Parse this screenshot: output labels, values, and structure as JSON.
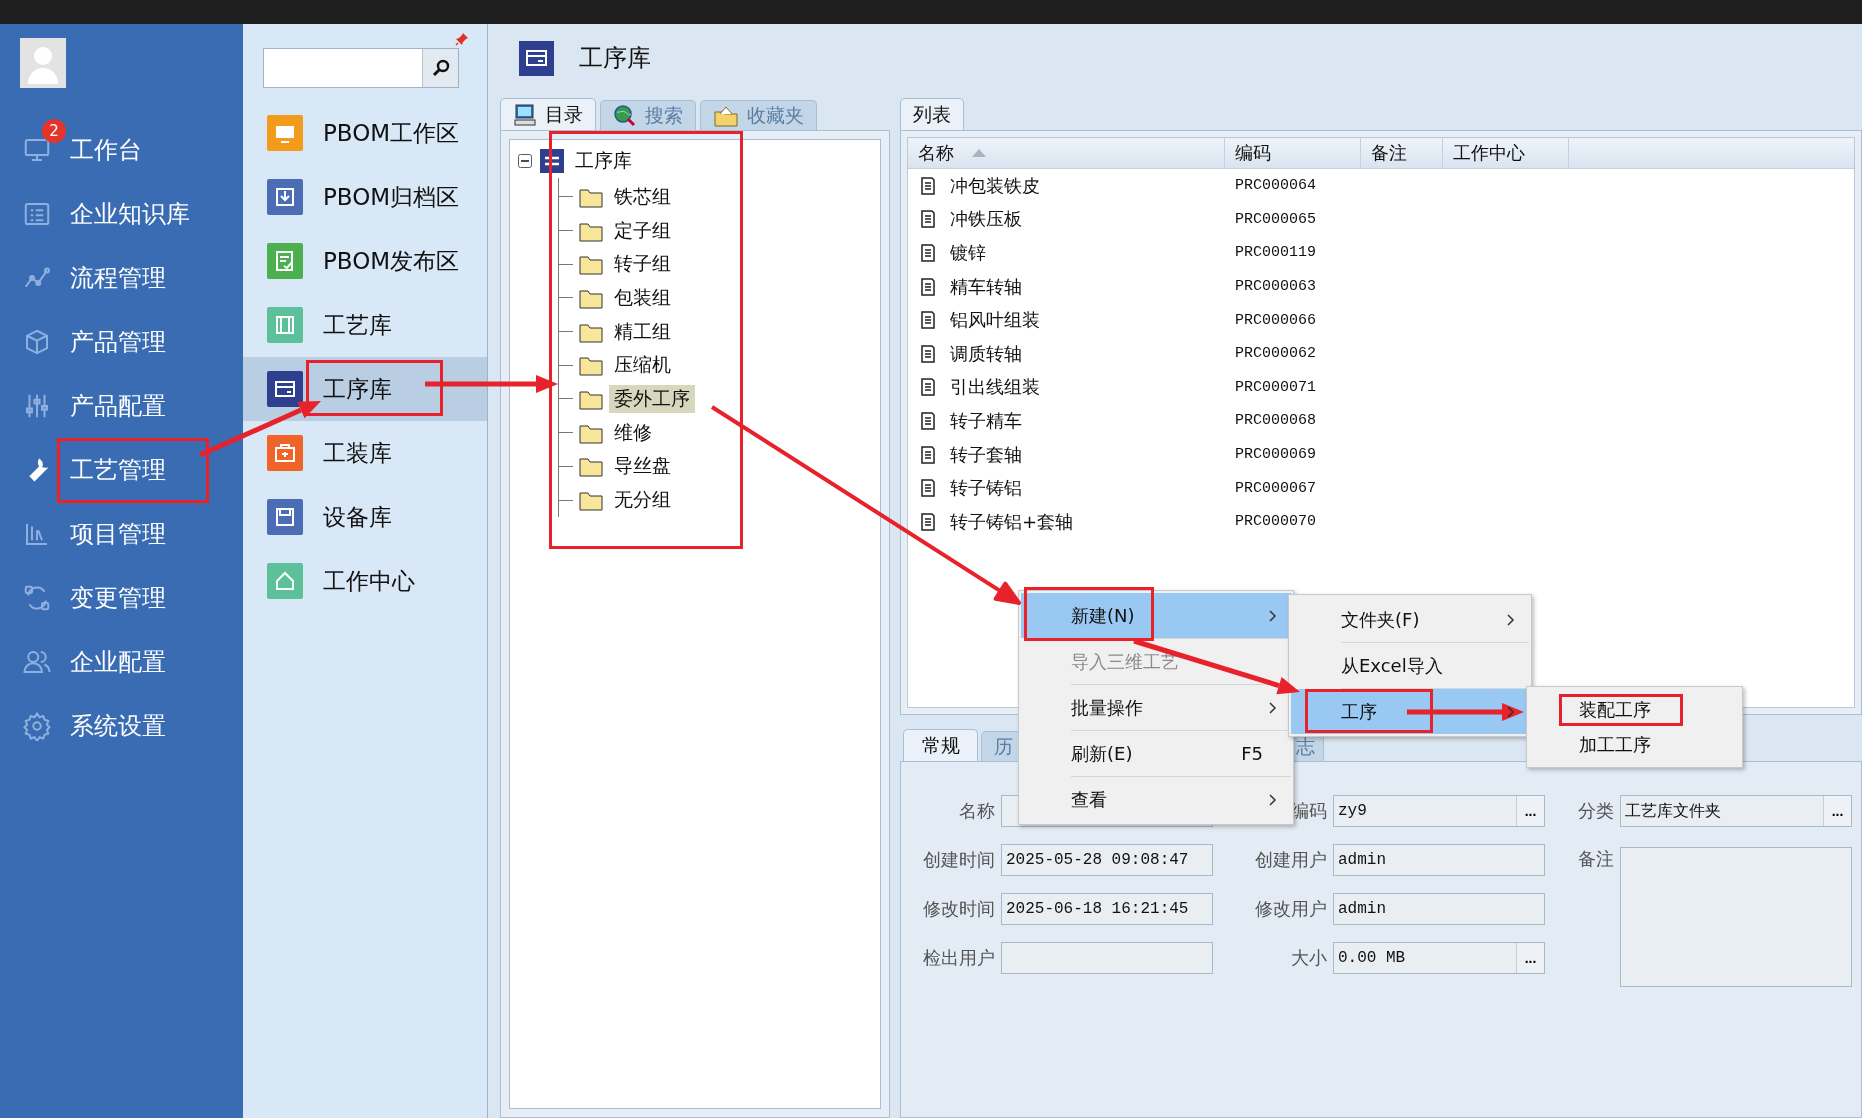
{
  "nav": {
    "items": [
      {
        "label": "工作台",
        "badge": "2",
        "selected": false
      },
      {
        "label": "企业知识库",
        "selected": false
      },
      {
        "label": "流程管理",
        "selected": false
      },
      {
        "label": "产品管理",
        "selected": false
      },
      {
        "label": "产品配置",
        "selected": false
      },
      {
        "label": "工艺管理",
        "selected": true
      },
      {
        "label": "项目管理",
        "selected": false
      },
      {
        "label": "变更管理",
        "selected": false
      },
      {
        "label": "企业配置",
        "selected": false
      },
      {
        "label": "系统设置",
        "selected": false
      }
    ]
  },
  "subnav": {
    "items": [
      {
        "label": "PBOM工作区",
        "color": "#f39c1b",
        "selected": false
      },
      {
        "label": "PBOM归档区",
        "color": "#4a6db5",
        "selected": false
      },
      {
        "label": "PBOM发布区",
        "color": "#4caf50",
        "selected": false
      },
      {
        "label": "工艺库",
        "color": "#5cc19b",
        "selected": false
      },
      {
        "label": "工序库",
        "color": "#2e3f8f",
        "selected": true
      },
      {
        "label": "工装库",
        "color": "#f0642a",
        "selected": false
      },
      {
        "label": "设备库",
        "color": "#4a6db5",
        "selected": false
      },
      {
        "label": "工作中心",
        "color": "#5cc19b",
        "selected": false
      }
    ]
  },
  "page": {
    "title": "工序库"
  },
  "left_tabs": [
    {
      "label": "目录",
      "selected": true
    },
    {
      "label": "搜索",
      "selected": false
    },
    {
      "label": "收藏夹",
      "selected": false
    }
  ],
  "tree": {
    "label": "工序库",
    "expanded": true,
    "children": [
      {
        "label": "铁芯组",
        "selected": false
      },
      {
        "label": "定子组",
        "selected": false
      },
      {
        "label": "转子组",
        "selected": false
      },
      {
        "label": "包装组",
        "selected": false
      },
      {
        "label": "精工组",
        "selected": false
      },
      {
        "label": "压缩机",
        "selected": false
      },
      {
        "label": "委外工序",
        "selected": true
      },
      {
        "label": "维修",
        "selected": false
      },
      {
        "label": "导丝盘",
        "selected": false
      },
      {
        "label": "无分组",
        "selected": false
      }
    ]
  },
  "list_tabs": [
    {
      "label": "列表",
      "selected": true
    }
  ],
  "table": {
    "columns": [
      {
        "label": "名称",
        "sorted": true
      },
      {
        "label": "编码",
        "sorted": false
      },
      {
        "label": "备注",
        "sorted": false
      },
      {
        "label": "工作中心",
        "sorted": false
      }
    ],
    "rows": [
      {
        "name": "冲包装铁皮",
        "code": "PRC000064"
      },
      {
        "name": "冲铁压板",
        "code": "PRC000065"
      },
      {
        "name": "镀锌",
        "code": "PRC000119"
      },
      {
        "name": "精车转轴",
        "code": "PRC000063"
      },
      {
        "name": "铝风叶组装",
        "code": "PRC000066"
      },
      {
        "name": "调质转轴",
        "code": "PRC000062"
      },
      {
        "name": "引出线组装",
        "code": "PRC000071"
      },
      {
        "name": "转子精车",
        "code": "PRC000068"
      },
      {
        "name": "转子套轴",
        "code": "PRC000069"
      },
      {
        "name": "转子铸铝",
        "code": "PRC000067"
      },
      {
        "name": "转子铸铝+套轴",
        "code": "PRC000070"
      }
    ]
  },
  "detail_tabs": [
    {
      "label": "常规",
      "selected": true
    },
    {
      "label": "历",
      "selected": false
    },
    {
      "label": "志",
      "selected": false
    }
  ],
  "form": {
    "rows": [
      [
        {
          "label": "名称",
          "kind": "text"
        },
        {
          "label": "编码",
          "kind": "picker",
          "value": "zy9",
          "button": "..."
        },
        {
          "label": "分类",
          "kind": "picker",
          "value": "工艺库文件夹",
          "button": "..."
        }
      ],
      [
        {
          "label": "创建时间",
          "kind": "text",
          "value": "2025-05-28 09:08:47"
        },
        {
          "label": "创建用户",
          "kind": "text",
          "value": "admin"
        },
        {
          "label": "备注",
          "kind": "textarea"
        }
      ],
      [
        {
          "label": "修改时间",
          "kind": "text",
          "value": "2025-06-18 16:21:45"
        },
        {
          "label": "修改用户",
          "kind": "text",
          "value": "admin"
        }
      ],
      [
        {
          "label": "检出用户",
          "kind": "text"
        },
        {
          "label": "大小",
          "kind": "picker",
          "value": "0.00 MB",
          "button": "..."
        }
      ]
    ]
  },
  "context_menu": {
    "items": [
      {
        "label": "新建(N)",
        "highlighted": true,
        "disabled": false,
        "submenu": true
      },
      {
        "label": "导入三维工艺",
        "highlighted": false,
        "disabled": true,
        "submenu": false
      },
      {
        "label": "批量操作",
        "highlighted": false,
        "disabled": false,
        "submenu": true
      },
      {
        "label": "刷新(E)",
        "highlighted": false,
        "disabled": false,
        "submenu": false,
        "shortcut": "F5"
      },
      {
        "label": "查看",
        "highlighted": false,
        "disabled": false,
        "submenu": true
      }
    ]
  },
  "submenu": {
    "items": [
      {
        "label": "文件夹(F)",
        "highlighted": false,
        "submenu": true
      },
      {
        "label": "从Excel导入",
        "highlighted": false,
        "submenu": false
      },
      {
        "label": "工序",
        "highlighted": true,
        "submenu": true
      }
    ]
  },
  "subsubmenu": {
    "items": [
      {
        "label": "装配工序",
        "highlighted": false
      },
      {
        "label": "加工工序",
        "highlighted": false
      }
    ]
  }
}
